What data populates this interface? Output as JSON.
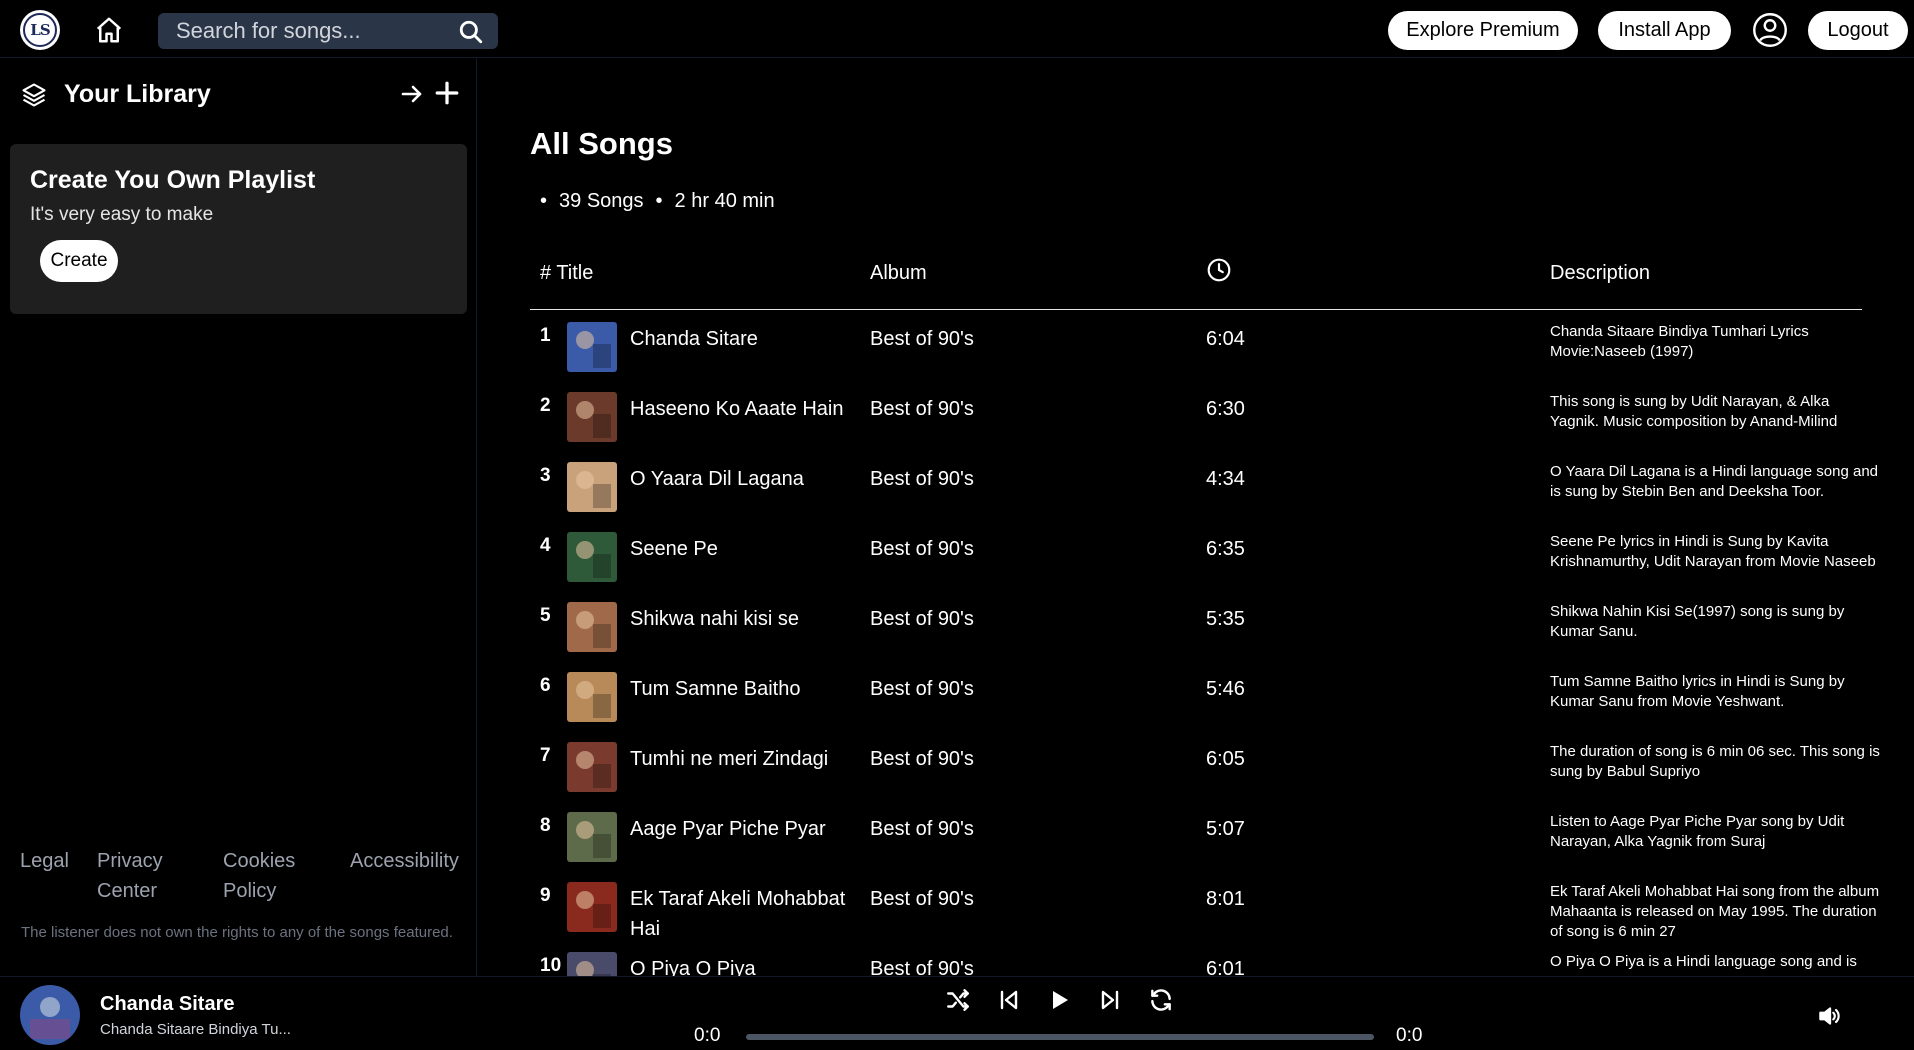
{
  "topbar": {
    "logo_text": "LS",
    "search_placeholder": "Search for songs...",
    "premium_label": "Explore Premium",
    "install_label": "Install App",
    "logout_label": "Logout"
  },
  "sidebar": {
    "library_title": "Your Library",
    "playlist_card": {
      "title": "Create You Own Playlist",
      "subtitle": "It's very easy to make",
      "button": "Create"
    },
    "footer_links": {
      "legal": "Legal",
      "privacy": "Privacy Center",
      "cookies": "Cookies Policy",
      "accessibility": "Accessibility"
    },
    "disclaimer": "The listener does not own the rights to any of the songs featured."
  },
  "main": {
    "title": "All Songs",
    "song_count": "39 Songs",
    "total_duration": "2 hr 40 min",
    "headers": {
      "title": "# Title",
      "album": "Album",
      "description": "Description"
    },
    "songs": [
      {
        "num": "1",
        "title": "Chanda Sitare",
        "album": "Best of 90's",
        "duration": "6:04",
        "description": "Chanda Sitaare Bindiya Tumhari Lyrics Movie:Naseeb (1997)",
        "thumb": "#3b5ba8"
      },
      {
        "num": "2",
        "title": "Haseeno Ko Aaate Hain",
        "album": "Best of 90's",
        "duration": "6:30",
        "description": "This song is sung by Udit Narayan, & Alka Yagnik. Music composition by Anand-Milind",
        "thumb": "#6b3a2a"
      },
      {
        "num": "3",
        "title": "O Yaara Dil Lagana",
        "album": "Best of 90's",
        "duration": "4:34",
        "description": "O Yaara Dil Lagana is a Hindi language song and is sung by Stebin Ben and Deeksha Toor.",
        "thumb": "#c9a27c"
      },
      {
        "num": "4",
        "title": "Seene Pe",
        "album": "Best of 90's",
        "duration": "6:35",
        "description": "Seene Pe lyrics in Hindi is Sung by Kavita Krishnamurthy, Udit Narayan from Movie Naseeb",
        "thumb": "#2f5a3a"
      },
      {
        "num": "5",
        "title": "Shikwa nahi kisi se",
        "album": "Best of 90's",
        "duration": "5:35",
        "description": "Shikwa Nahin Kisi Se(1997) song is sung by Kumar Sanu.",
        "thumb": "#a06a4a"
      },
      {
        "num": "6",
        "title": "Tum Samne Baitho",
        "album": "Best of 90's",
        "duration": "5:46",
        "description": "Tum Samne Baitho lyrics in Hindi is Sung by Kumar Sanu from Movie Yeshwant.",
        "thumb": "#b88a5a"
      },
      {
        "num": "7",
        "title": "Tumhi ne meri Zindagi",
        "album": "Best of 90's",
        "duration": "6:05",
        "description": "The duration of song is 6 min 06 sec. This song is sung by Babul Supriyo",
        "thumb": "#7a3b2e"
      },
      {
        "num": "8",
        "title": "Aage Pyar Piche Pyar",
        "album": "Best of 90's",
        "duration": "5:07",
        "description": "Listen to Aage Pyar Piche Pyar song by Udit Narayan, Alka Yagnik from Suraj",
        "thumb": "#5d6b4a"
      },
      {
        "num": "9",
        "title": "Ek Taraf Akeli Mohabbat Hai",
        "album": "Best of 90's",
        "duration": "8:01",
        "description": "Ek Taraf Akeli Mohabbat Hai song from the album Mahaanta is released on May 1995. The duration of song is 6 min 27",
        "thumb": "#8a2a1e"
      },
      {
        "num": "10",
        "title": "O Piya O Piya",
        "album": "Best of 90's",
        "duration": "6:01",
        "description": "O Piya O Piya is a Hindi language song and is",
        "thumb": "#4a4a6a"
      }
    ]
  },
  "player": {
    "title": "Chanda Sitare",
    "description": "Chanda Sitaare Bindiya Tu...",
    "current_time": "0:0",
    "total_time": "0:0",
    "progress": 0
  }
}
